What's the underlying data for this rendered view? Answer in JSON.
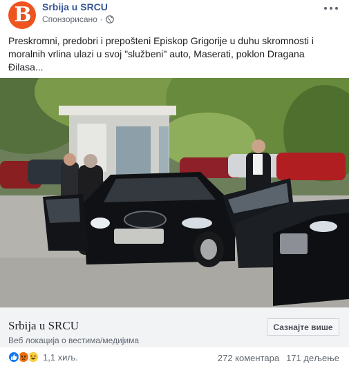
{
  "header": {
    "avatar_letter": "B",
    "page_name": "Srbija u SRCU",
    "sponsored": "Спонзорисано",
    "dot": "·",
    "icons": {
      "privacy": "globe-icon",
      "menu": "more-options-icon"
    }
  },
  "post": {
    "text": "Preskromni, predobri i prepošteni Episkop Grigorije u duhu skromnosti i moralnih vrlina ulazi u svoj \"službeni\" auto, Maserati, poklon Dragana Đilasa..."
  },
  "link": {
    "title": "Srbija u SRCU",
    "subtitle": "Веб локација о вестима/медијима",
    "cta": "Сазнајте више"
  },
  "footer": {
    "reaction_count": "1,1 хиљ.",
    "comments": "272 коментара",
    "shares": "171 дељење",
    "reaction_icons": [
      "like-icon",
      "angry-icon",
      "haha-icon"
    ]
  },
  "colors": {
    "brand_link": "#385898",
    "avatar_bg": "#f0541e",
    "like_blue": "#1877f2"
  }
}
